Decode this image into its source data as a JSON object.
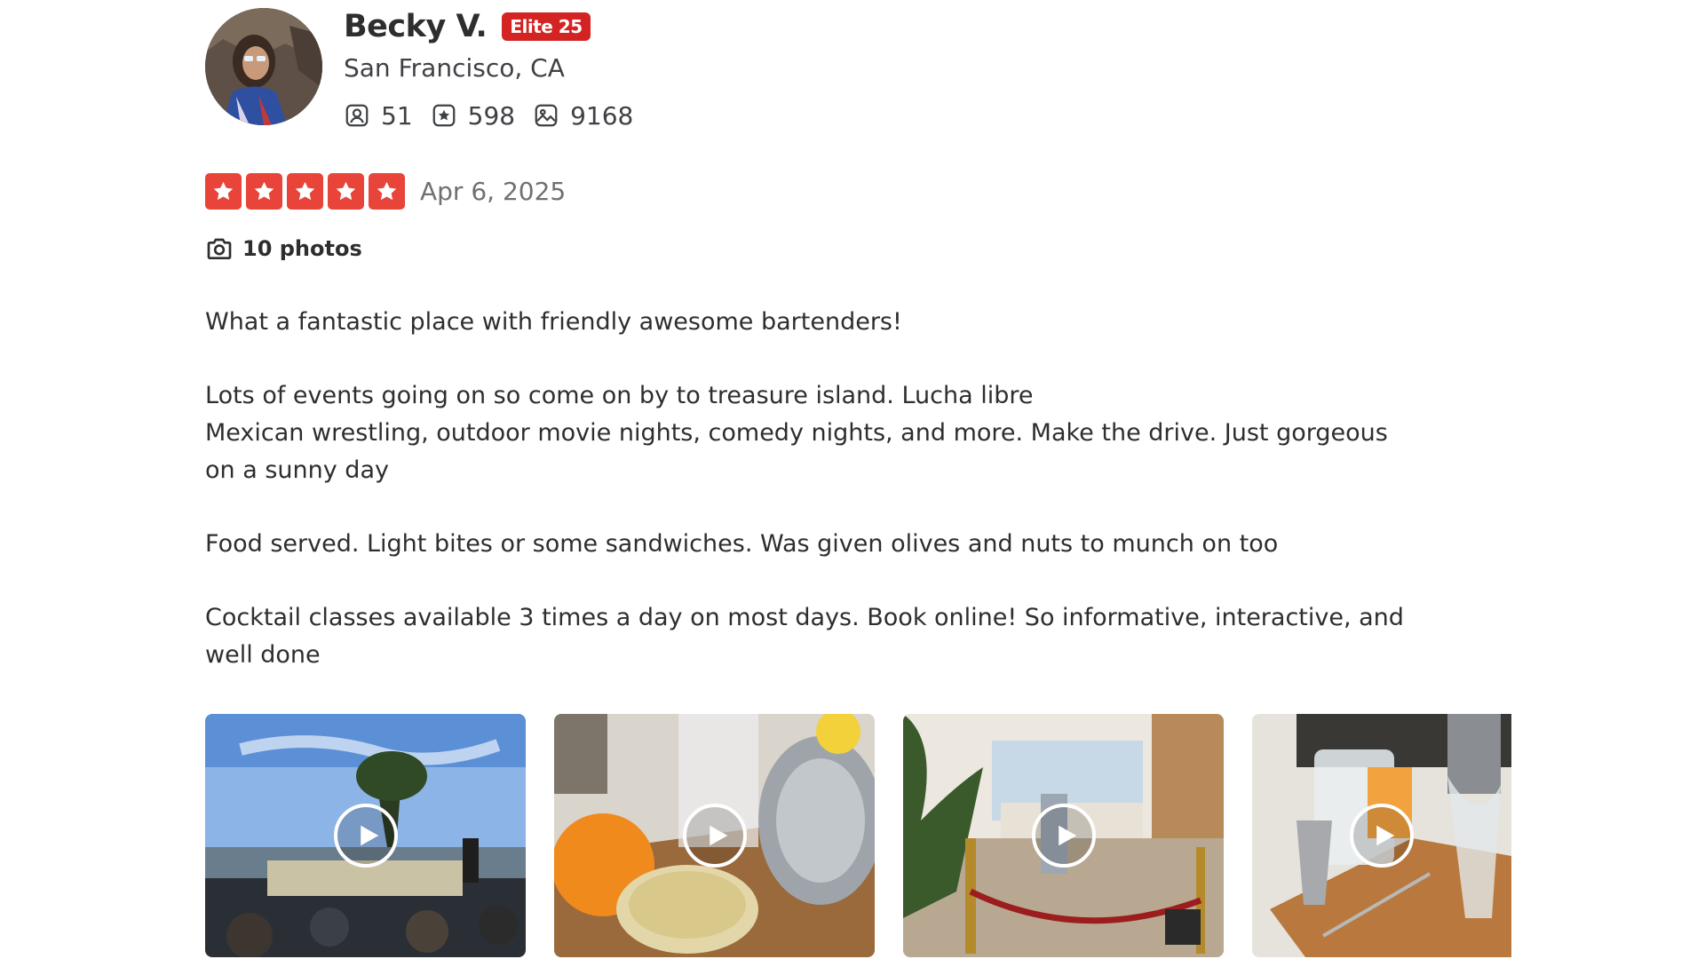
{
  "user": {
    "name": "Becky V.",
    "elite_badge": "Elite 25",
    "location": "San Francisco, CA",
    "stats": {
      "friends": "51",
      "reviews": "598",
      "photos": "9168"
    }
  },
  "review": {
    "rating": 5,
    "date": "Apr 6, 2025",
    "photos_label": "10 photos",
    "paragraphs": [
      "What a fantastic place with friendly awesome bartenders!",
      "Lots of events going on so come on by to treasure island. Lucha libre\nMexican wrestling, outdoor movie nights, comedy nights, and more. Make the drive. Just gorgeous on a sunny day",
      "Food served. Light bites or some sandwiches. Was given olives and nuts to munch on too",
      "Cocktail classes available 3 times a day on most days. Book online! So informative, interactive, and well done"
    ]
  },
  "media": [
    {
      "kind": "video",
      "icon": "play-icon"
    },
    {
      "kind": "video",
      "icon": "play-icon"
    },
    {
      "kind": "video",
      "icon": "play-icon"
    },
    {
      "kind": "video",
      "icon": "play-icon"
    }
  ],
  "colors": {
    "star": "#e8443a",
    "elite": "#d32323",
    "text": "#2d2e2f",
    "muted": "#6e7072"
  }
}
